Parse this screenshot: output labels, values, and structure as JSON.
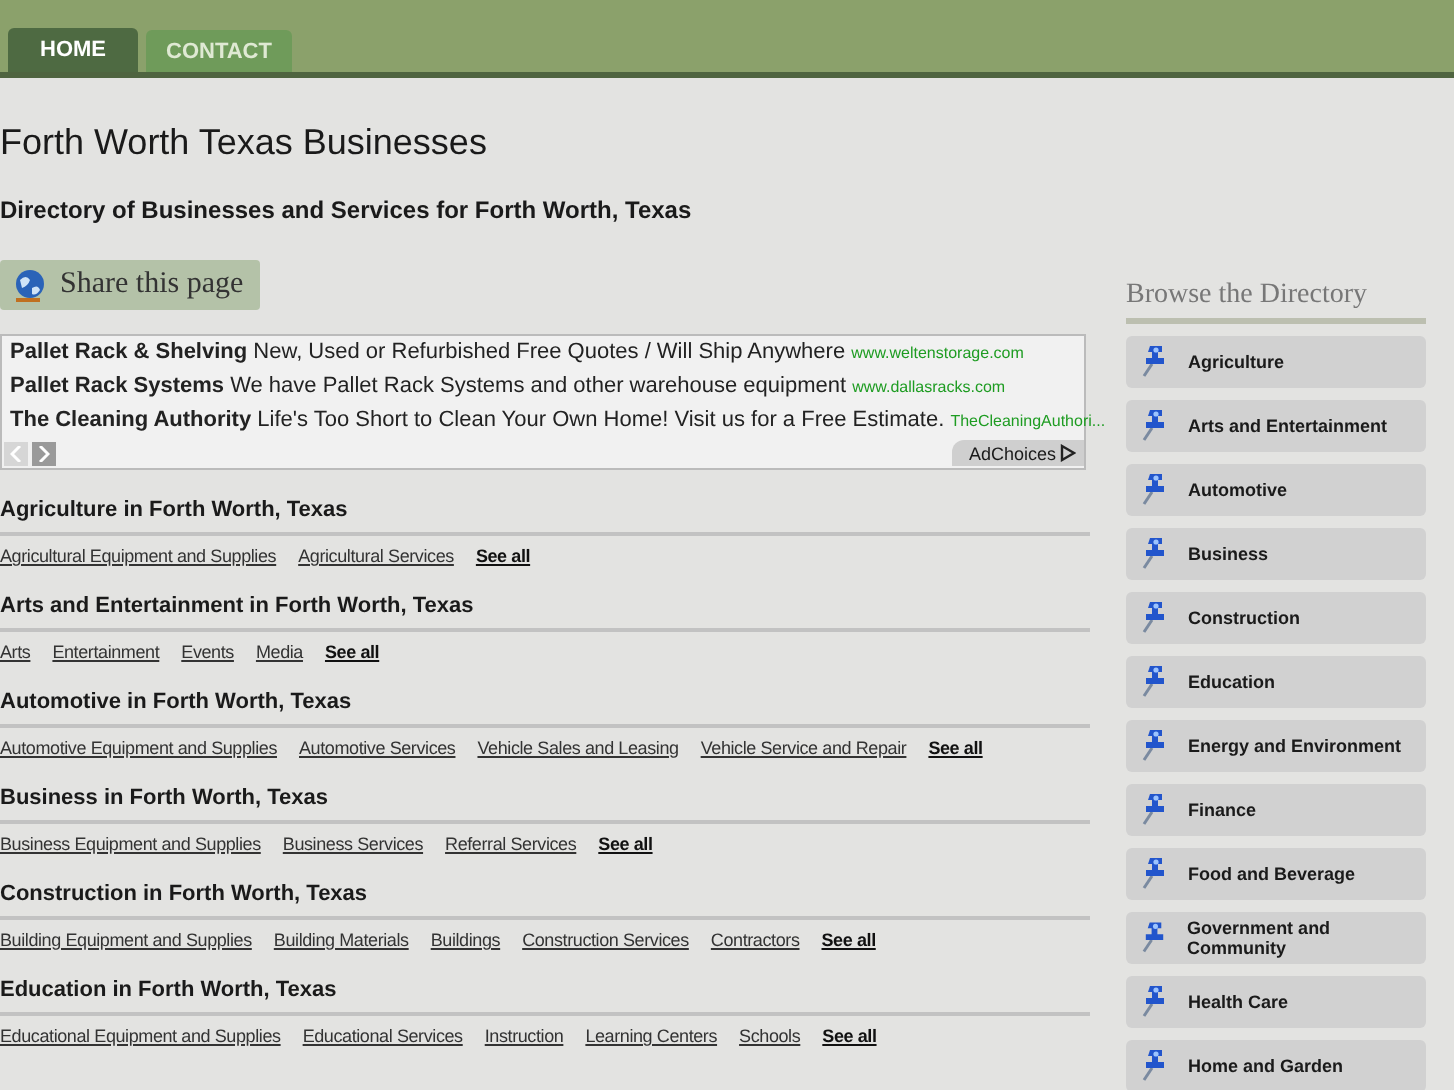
{
  "tabs": [
    {
      "label": "HOME",
      "selected": true
    },
    {
      "label": "CONTACT",
      "selected": false
    }
  ],
  "title": "Forth Worth Texas Businesses",
  "subtitle": "Directory of Businesses and Services for Forth Worth, Texas",
  "share_button": "Share this page",
  "ads": {
    "items": [
      {
        "title": "Pallet Rack & Shelving",
        "text": "New, Used or Refurbished Free Quotes / Will Ship Anywhere",
        "url": "www.weltenstorage.com"
      },
      {
        "title": "Pallet Rack Systems",
        "text": "We have Pallet Rack Systems and other warehouse equipment",
        "url": "www.dallasracks.com"
      },
      {
        "title": "The Cleaning Authority",
        "text": "Life's Too Short to Clean Your Own Home! Visit us for a Free Estimate.",
        "url": "TheCleaningAuthori..."
      }
    ],
    "prev_disabled": true,
    "next_disabled": false,
    "adchoices": "AdChoices"
  },
  "sections": [
    {
      "heading": "Agriculture in Forth Worth, Texas",
      "links": [
        "Agricultural Equipment and Supplies",
        "Agricultural Services"
      ],
      "see_all": "See all"
    },
    {
      "heading": "Arts and Entertainment in Forth Worth, Texas",
      "links": [
        "Arts",
        "Entertainment",
        "Events",
        "Media"
      ],
      "see_all": "See all"
    },
    {
      "heading": "Automotive in Forth Worth, Texas",
      "links": [
        "Automotive Equipment and Supplies",
        "Automotive Services",
        "Vehicle Sales and Leasing",
        "Vehicle Service and Repair"
      ],
      "see_all": "See all"
    },
    {
      "heading": "Business in Forth Worth, Texas",
      "links": [
        "Business Equipment and Supplies",
        "Business Services",
        "Referral Services"
      ],
      "see_all": "See all"
    },
    {
      "heading": "Construction in Forth Worth, Texas",
      "links": [
        "Building Equipment and Supplies",
        "Building Materials",
        "Buildings",
        "Construction Services",
        "Contractors"
      ],
      "see_all": "See all"
    },
    {
      "heading": "Education in Forth Worth, Texas",
      "links": [
        "Educational Equipment and Supplies",
        "Educational Services",
        "Instruction",
        "Learning Centers",
        "Schools"
      ],
      "see_all": "See all"
    }
  ],
  "sidebar": {
    "title": "Browse the Directory",
    "items": [
      "Agriculture",
      "Arts and Entertainment",
      "Automotive",
      "Business",
      "Construction",
      "Education",
      "Energy and Environment",
      "Finance",
      "Food and Beverage",
      "Government and Community",
      "Health Care",
      "Home and Garden"
    ]
  }
}
